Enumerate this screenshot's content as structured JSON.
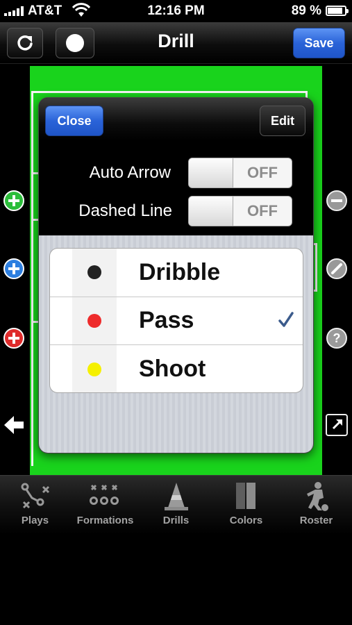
{
  "status_bar": {
    "carrier": "AT&T",
    "time": "12:16 PM",
    "battery": "89 %"
  },
  "nav": {
    "title": "Drill",
    "save_label": "Save"
  },
  "popover": {
    "close_label": "Close",
    "edit_label": "Edit",
    "options": [
      {
        "label": "Auto Arrow",
        "state": "OFF"
      },
      {
        "label": "Dashed Line",
        "state": "OFF"
      }
    ],
    "items": [
      {
        "label": "Dribble",
        "color": "#222222",
        "selected": false
      },
      {
        "label": "Pass",
        "color": "#ee2b2b",
        "selected": true
      },
      {
        "label": "Shoot",
        "color": "#f5f000",
        "selected": false
      }
    ]
  },
  "tabs": [
    {
      "label": "Plays",
      "icon": "plays-icon"
    },
    {
      "label": "Formations",
      "icon": "formations-icon"
    },
    {
      "label": "Drills",
      "icon": "cone-icon"
    },
    {
      "label": "Colors",
      "icon": "colors-icon"
    },
    {
      "label": "Roster",
      "icon": "player-icon"
    }
  ],
  "colors": {
    "field": "#19d31c",
    "accent_blue": "#2a63d8",
    "check": "#3b5b8c"
  }
}
